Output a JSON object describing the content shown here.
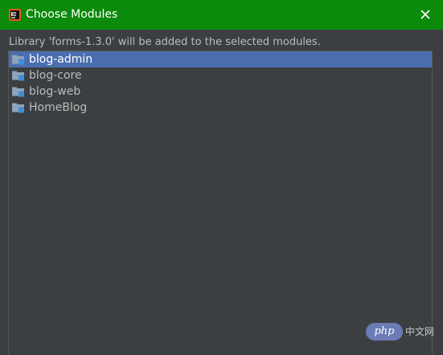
{
  "dialog": {
    "title": "Choose Modules",
    "app_icon": "intellij-idea-icon",
    "close_icon": "close-icon",
    "description": "Library 'forms-1.3.0' will be added to the selected modules."
  },
  "modules": [
    {
      "label": "blog-admin",
      "icon": "module-folder-icon",
      "selected": true
    },
    {
      "label": "blog-core",
      "icon": "module-folder-icon",
      "selected": false
    },
    {
      "label": "blog-web",
      "icon": "module-folder-icon",
      "selected": false
    },
    {
      "label": "HomeBlog",
      "icon": "module-folder-icon",
      "selected": false
    }
  ],
  "watermark": {
    "logo_text": "php",
    "site_text": "中文网"
  },
  "colors": {
    "titlebar": "#0b8a0b",
    "background": "#3c3f41",
    "selection": "#4b6eaf",
    "text": "#bbbbbb",
    "folder": "#8fa4ba",
    "module_badge": "#3d8fd6"
  }
}
